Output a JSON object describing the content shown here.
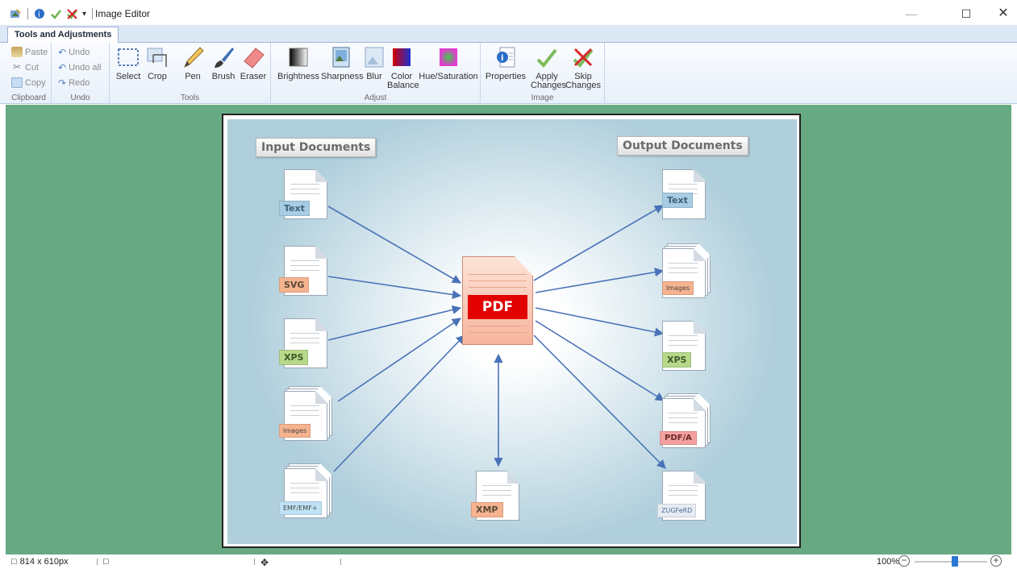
{
  "window": {
    "title": "Image Editor"
  },
  "ribbon": {
    "tab": "Tools and Adjustments",
    "clipboard": {
      "label": "Clipboard",
      "paste": "Paste",
      "cut": "Cut",
      "copy": "Copy"
    },
    "undo": {
      "label": "Undo",
      "undo": "Undo",
      "undo_all": "Undo all",
      "redo": "Redo"
    },
    "tools": {
      "label": "Tools",
      "select": "Select",
      "crop": "Crop",
      "pen": "Pen",
      "brush": "Brush",
      "eraser": "Eraser"
    },
    "adjust": {
      "label": "Adjust",
      "brightness": "Brightness",
      "sharpness": "Sharpness",
      "blur": "Blur",
      "color_balance_1": "Color",
      "color_balance_2": "Balance",
      "hue_saturation": "Hue/Saturation"
    },
    "image": {
      "label": "Image",
      "properties": "Properties",
      "apply_1": "Apply",
      "apply_2": "Changes",
      "skip_1": "Skip",
      "skip_2": "Changes"
    }
  },
  "diagram": {
    "input_header": "Input Documents",
    "output_header": "Output Documents",
    "center": "PDF",
    "inputs": [
      "Text",
      "SVG",
      "XPS",
      "Images",
      "EMF/EMF+"
    ],
    "outputs": [
      "Text",
      "Images",
      "XPS",
      "PDF/A",
      "ZUGFeRD"
    ],
    "bottom": "XMP",
    "tag_colors": {
      "Text": "#a6cde3",
      "SVG": "#f6b38f",
      "XPS": "#b8d88a",
      "Images": "#f6b38f",
      "EMF/EMF+": "#bfe3f5",
      "PDF/A": "#f4a0a0",
      "ZUGFeRD": "#e7ecf2",
      "XMP": "#f6b38f"
    }
  },
  "status": {
    "size": "814 x 610px",
    "zoom": "100%"
  },
  "colors": {
    "workspace": "#67a982",
    "arrow": "#4a72b8"
  }
}
